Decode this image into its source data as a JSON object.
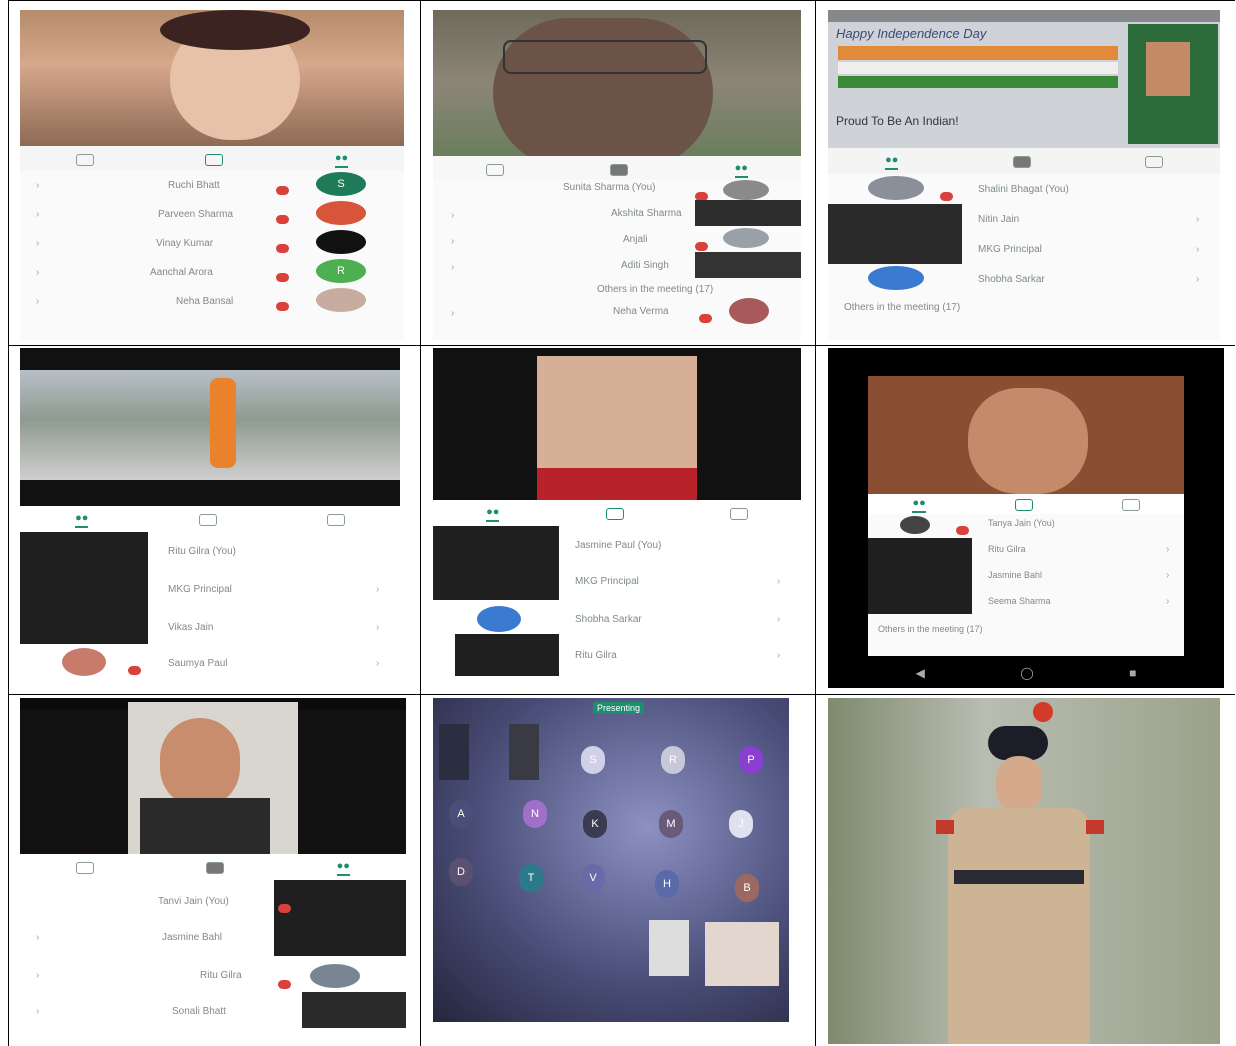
{
  "colors": {
    "accent": "#1e8e6e",
    "badge": "#d9413b",
    "dark": "#111111",
    "grid_line": "#000000"
  },
  "panel1": {
    "tabs": [
      "people-icon",
      "chat-icon",
      "info-icon"
    ],
    "participants": [
      {
        "name": "Ruchi Bhatt",
        "avatar_letter": "S",
        "avatar_color": "#1f7a5a"
      },
      {
        "name": "Parveen Sharma",
        "avatar_letter": "",
        "avatar_color": "#d8553b"
      },
      {
        "name": "Vinay Kumar",
        "avatar_letter": "",
        "avatar_color": "#111111"
      },
      {
        "name": "Aanchal Arora",
        "avatar_letter": "R",
        "avatar_color": "#4caf50"
      },
      {
        "name": "Neha Bansal",
        "avatar_letter": "",
        "avatar_color": "#c9aca0"
      }
    ]
  },
  "panel2": {
    "participants": [
      {
        "name": "Sunita Sharma (You)"
      },
      {
        "name": "Akshita Sharma"
      },
      {
        "name": "Anjali"
      },
      {
        "name": "Aditi Singh"
      },
      {
        "name": "Neha Verma"
      }
    ],
    "others_text": "Others in the meeting (17)"
  },
  "panel3": {
    "banner_line1": "Happy Independence Day",
    "banner_line2": "Proud To Be An Indian!",
    "participants": [
      {
        "name": "Shalini Bhagat (You)"
      },
      {
        "name": "Nitin Jain"
      },
      {
        "name": "MKG Principal"
      },
      {
        "name": "Shobha Sarkar"
      }
    ],
    "others_text": "Others in the meeting (17)"
  },
  "panel4": {
    "participants": [
      {
        "name": "Ritu Gilra (You)"
      },
      {
        "name": "MKG Principal"
      },
      {
        "name": "Vikas Jain"
      },
      {
        "name": "Saumya Paul"
      }
    ]
  },
  "panel5": {
    "participants": [
      {
        "name": "Jasmine Paul (You)"
      },
      {
        "name": "MKG Principal"
      },
      {
        "name": "Shobha Sarkar"
      },
      {
        "name": "Ritu Gilra"
      }
    ]
  },
  "panel6": {
    "participants": [
      {
        "name": "Tanya Jain (You)"
      },
      {
        "name": "Ritu Gilra"
      },
      {
        "name": "Jasmine Bahl"
      },
      {
        "name": "Seema Sharma"
      }
    ],
    "others_text": "Others in the meeting (17)"
  },
  "panel7": {
    "participants": [
      {
        "name": "Tanvi Jain (You)"
      },
      {
        "name": "Jasmine Bahl"
      },
      {
        "name": "Ritu Gilra"
      },
      {
        "name": "Sonali Bhatt"
      }
    ]
  },
  "panel8": {
    "presenter_label": "Presenting",
    "tiles": [
      "S",
      "R",
      "P",
      "A",
      "N",
      "K",
      "M",
      "J",
      "D",
      "T",
      "V",
      "H",
      "B"
    ]
  },
  "panel9": {}
}
